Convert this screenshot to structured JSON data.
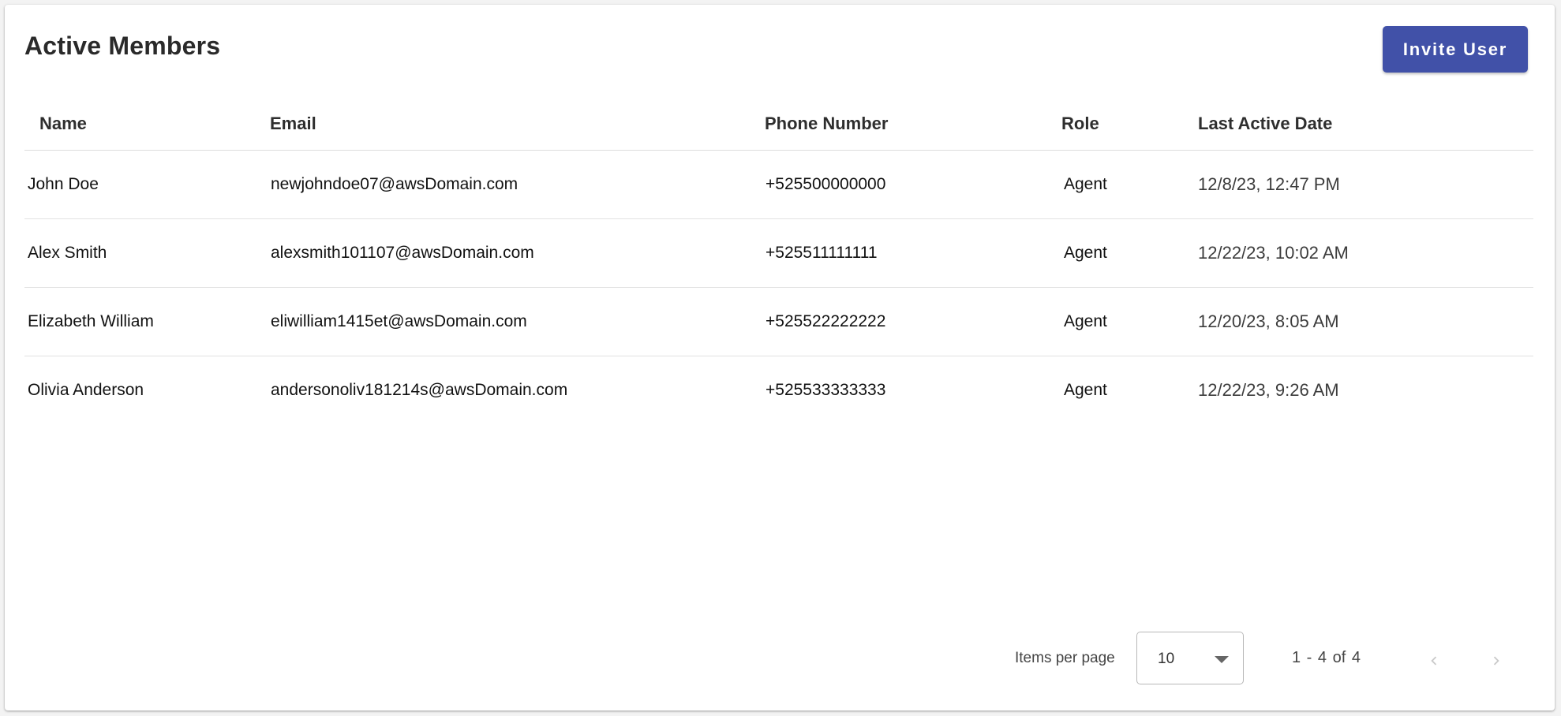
{
  "header": {
    "title": "Active Members",
    "invite_label": "Invite User"
  },
  "table": {
    "columns": {
      "name": "Name",
      "email": "Email",
      "phone": "Phone Number",
      "role": "Role",
      "last_active": "Last Active Date"
    },
    "rows": [
      {
        "name": "John Doe",
        "email": "newjohndoe07@awsDomain.com",
        "phone": "+525500000000",
        "role": "Agent",
        "last_active": "12/8/23, 12:47 PM"
      },
      {
        "name": "Alex Smith",
        "email": "alexsmith101107@awsDomain.com",
        "phone": "+525511111111",
        "role": "Agent",
        "last_active": "12/22/23, 10:02 AM"
      },
      {
        "name": "Elizabeth William",
        "email": "eliwilliam1415et@awsDomain.com",
        "phone": "+525522222222",
        "role": "Agent",
        "last_active": "12/20/23, 8:05 AM"
      },
      {
        "name": "Olivia Anderson",
        "email": "andersonoliv181214s@awsDomain.com",
        "phone": "+525533333333",
        "role": "Agent",
        "last_active": "12/22/23, 9:26 AM"
      }
    ]
  },
  "paginator": {
    "items_per_page_label": "Items per page",
    "page_size": "10",
    "range_label": "1 - 4 of 4",
    "prev_icon": "chevron-left-icon",
    "next_icon": "chevron-right-icon"
  },
  "colors": {
    "accent": "#4151a8",
    "divider": "#e2e2e2"
  }
}
